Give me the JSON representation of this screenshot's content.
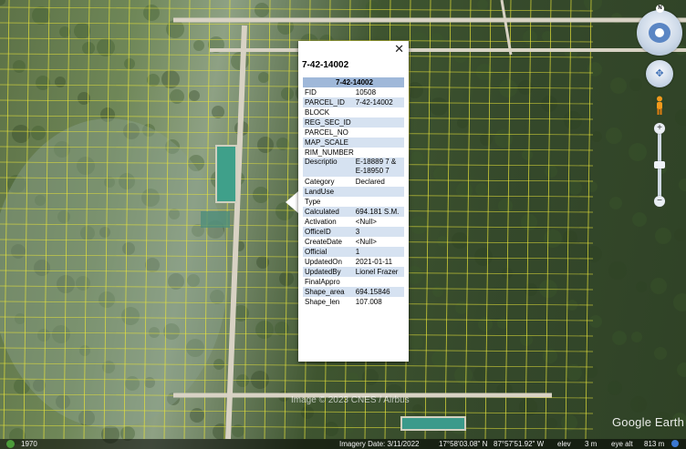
{
  "balloon": {
    "title": "7-42-14002",
    "close_icon": "close-icon",
    "table_header": "7-42-14002",
    "rows": [
      {
        "key": "FID",
        "value": "10508"
      },
      {
        "key": "PARCEL_ID",
        "value": "7-42-14002"
      },
      {
        "key": "BLOCK",
        "value": ""
      },
      {
        "key": "REG_SEC_ID",
        "value": ""
      },
      {
        "key": "PARCEL_NO",
        "value": ""
      },
      {
        "key": "MAP_SCALE",
        "value": ""
      },
      {
        "key": "RIM_NUMBER",
        "value": ""
      },
      {
        "key": "Descriptio",
        "value": "E-18889 7 & E-18950 7"
      },
      {
        "key": "Category",
        "value": "Declared"
      },
      {
        "key": "LandUse",
        "value": ""
      },
      {
        "key": "Type",
        "value": ""
      },
      {
        "key": "Calculated",
        "value": "694.181 S.M."
      },
      {
        "key": "Activation",
        "value": "<Null>"
      },
      {
        "key": "OfficeID",
        "value": "3"
      },
      {
        "key": "CreateDate",
        "value": "<Null>"
      },
      {
        "key": "Official",
        "value": "1"
      },
      {
        "key": "UpdatedOn",
        "value": "2021-01-11"
      },
      {
        "key": "UpdatedBy",
        "value": "Lionel Frazer"
      },
      {
        "key": "FinalAppro",
        "value": ""
      },
      {
        "key": "Shape_area",
        "value": "694.15846"
      },
      {
        "key": "Shape_len",
        "value": "107.008"
      }
    ]
  },
  "navigation": {
    "north_label": "N",
    "compass_icon": "compass-icon",
    "look_icon": "look-joystick-icon",
    "pegman_icon": "street-view-pegman-icon",
    "zoom_in_icon": "zoom-in-icon",
    "zoom_out_icon": "zoom-out-icon",
    "zoom_in_label": "+",
    "zoom_out_label": "−"
  },
  "map": {
    "watermark": "Image © 2023 CNES / Airbus",
    "logo": "Google Earth",
    "parcel_line_color": "#e6e23a",
    "road_color": "#d8d2c4"
  },
  "statusbar": {
    "historical_icon": "historical-imagery-icon",
    "year": "1970",
    "imagery_date": "Imagery Date: 3/11/2022",
    "latitude": "17°58'03.08\" N",
    "longitude": "87°57'51.92\" W",
    "elev_label": "elev",
    "elev_value": "3 m",
    "eye_alt": "eye alt",
    "eye_alt_value": "813 m",
    "stream_icon": "streaming-indicator-icon"
  }
}
